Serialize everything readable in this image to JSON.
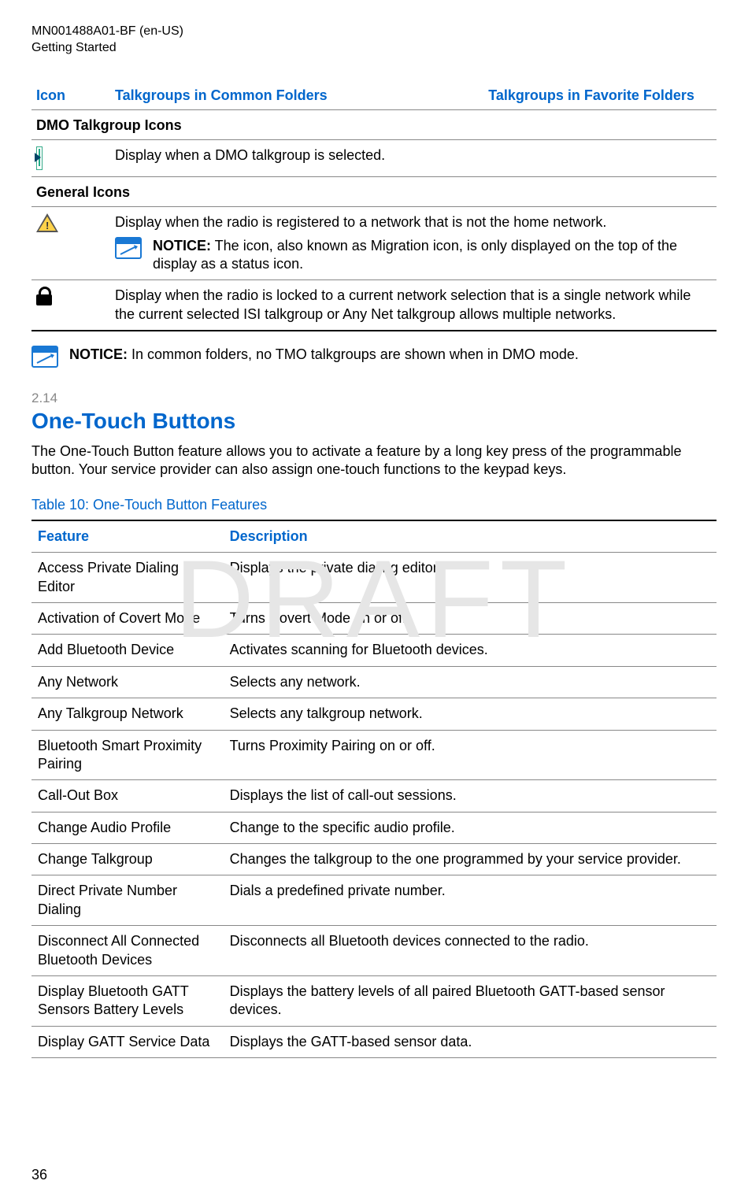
{
  "meta": {
    "doc_id": "MN001488A01-BF (en-US)",
    "chapter": "Getting Started"
  },
  "watermark": "DRAFT",
  "icon_table": {
    "headers": {
      "icon": "Icon",
      "common": "Talkgroups in Common Folders",
      "favorite": "Talkgroups in Favorite Folders"
    },
    "section_dmo": "DMO Talkgroup Icons",
    "row_dmo": {
      "desc": "Display when a DMO talkgroup is selected."
    },
    "section_general": "General Icons",
    "row_migration": {
      "desc": "Display when the radio is registered to a network that is not the home network.",
      "notice_label": "NOTICE:",
      "notice_text": " The icon, also known as Migration icon, is only displayed on the top of the display as a status icon."
    },
    "row_lock": {
      "desc": "Display when the radio is locked to a current network selection that is a single network while the current selected ISI talkgroup or Any Net talkgroup allows multiple networks."
    }
  },
  "notice_after_table": {
    "label": "NOTICE:",
    "text": " In common folders, no TMO talkgroups are shown when in DMO mode."
  },
  "section": {
    "number": "2.14",
    "title": "One-Touch Buttons",
    "intro": "The One-Touch Button feature allows you to activate a feature by a long key press of the programmable button. Your service provider can also assign one-touch functions to the keypad keys."
  },
  "feature_table": {
    "caption": "Table 10: One-Touch Button Features",
    "headers": {
      "feature": "Feature",
      "description": "Description"
    },
    "rows": [
      {
        "feature": "Access Private Dialing Editor",
        "description": "Displays the private dialing editor."
      },
      {
        "feature": "Activation of Covert Mode",
        "description": "Turns Covert Mode on or off."
      },
      {
        "feature": "Add Bluetooth Device",
        "description": "Activates scanning for Bluetooth devices."
      },
      {
        "feature": "Any Network",
        "description": "Selects any network."
      },
      {
        "feature": "Any Talkgroup Network",
        "description": "Selects any talkgroup network."
      },
      {
        "feature": "Bluetooth Smart Proximity Pairing",
        "description": "Turns Proximity Pairing on or off."
      },
      {
        "feature": "Call-Out Box",
        "description": "Displays the list of call-out sessions."
      },
      {
        "feature": "Change Audio Profile",
        "description": "Change to the specific audio profile."
      },
      {
        "feature": "Change Talkgroup",
        "description": "Changes the talkgroup to the one programmed by your service provider."
      },
      {
        "feature": "Direct Private Number Dialing",
        "description": "Dials a predefined private number."
      },
      {
        "feature": "Disconnect All Connected Bluetooth Devices",
        "description": "Disconnects all Bluetooth devices connected to the radio."
      },
      {
        "feature": "Display Bluetooth GATT Sensors Battery Levels",
        "description": "Displays the battery levels of all paired Bluetooth GATT-based sensor devices."
      },
      {
        "feature": "Display GATT Service Data",
        "description": "Displays the GATT-based sensor data."
      }
    ]
  },
  "page_number": "36"
}
